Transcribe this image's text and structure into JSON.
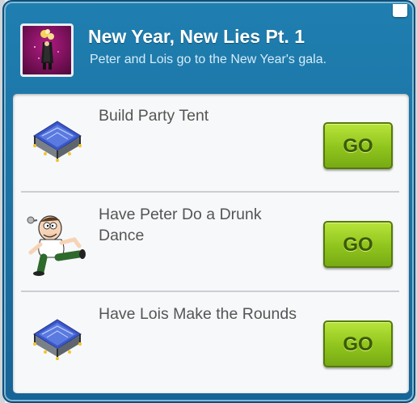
{
  "quest": {
    "title": "New Year, New Lies Pt. 1",
    "description": "Peter and Lois go to the New Year's gala."
  },
  "tasks": [
    {
      "label": "Build Party Tent",
      "button": "GO",
      "icon": "party-tent-icon"
    },
    {
      "label": "Have Peter Do a Drunk Dance",
      "button": "GO",
      "icon": "peter-dancing-icon"
    },
    {
      "label": "Have Lois Make the Rounds",
      "button": "GO",
      "icon": "party-tent-icon"
    }
  ],
  "colors": {
    "dialog_blue": "#1b6fa1",
    "go_green": "#8fc41d",
    "panel": "#f7f8f9",
    "quest_icon_bg": "#8a1264"
  }
}
